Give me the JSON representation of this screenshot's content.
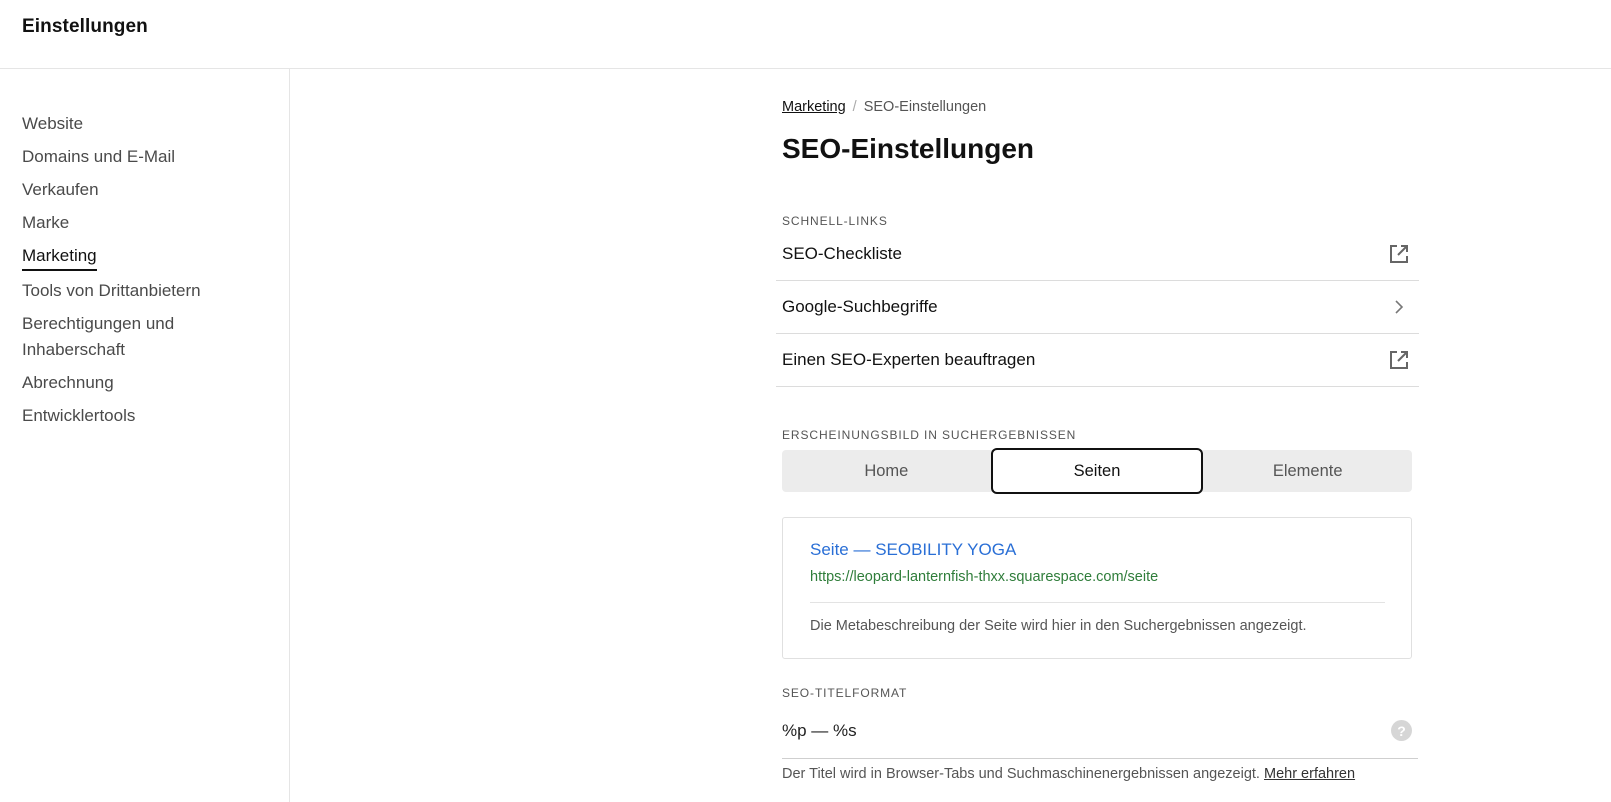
{
  "app": {
    "title": "Einstellungen"
  },
  "sidebar": {
    "items": [
      {
        "label": "Website"
      },
      {
        "label": "Domains und E-Mail"
      },
      {
        "label": "Verkaufen"
      },
      {
        "label": "Marke"
      },
      {
        "label": "Marketing",
        "active": true
      },
      {
        "label": "Tools von Drittanbietern"
      },
      {
        "label": "Berechtigungen und Inhaberschaft"
      },
      {
        "label": "Abrechnung"
      },
      {
        "label": "Entwicklertools"
      }
    ]
  },
  "breadcrumb": {
    "parent": "Marketing",
    "separator": "/",
    "current": "SEO-Einstellungen"
  },
  "page": {
    "title": "SEO-Einstellungen"
  },
  "quick_links": {
    "label": "SCHNELL-LINKS",
    "items": [
      {
        "label": "SEO-Checkliste",
        "icon": "external-link-icon"
      },
      {
        "label": "Google-Suchbegriffe",
        "icon": "chevron-right-icon"
      },
      {
        "label": "Einen SEO-Experten beauftragen",
        "icon": "external-link-icon"
      }
    ]
  },
  "appearance": {
    "label": "ERSCHEINUNGSBILD IN SUCHERGEBNISSEN",
    "tabs": [
      {
        "label": "Home"
      },
      {
        "label": "Seiten",
        "active": true
      },
      {
        "label": "Elemente"
      }
    ],
    "preview": {
      "title": "Seite — SEOBILITY YOGA",
      "url": "https://leopard-lanternfish-thxx.squarespace.com/seite",
      "description": "Die Metabeschreibung der Seite wird hier in den Suchergebnissen angezeigt."
    }
  },
  "title_format": {
    "label": "SEO-TITELFORMAT",
    "value": "%p — %s",
    "help_icon": "?",
    "hint": "Der Titel wird in Browser-Tabs und Suchmaschinenergebnissen angezeigt.",
    "learn_more": "Mehr erfahren"
  },
  "colors": {
    "link_blue": "#2a6fd6",
    "url_green": "#2f7d3a",
    "segment_bg": "#ececec"
  }
}
